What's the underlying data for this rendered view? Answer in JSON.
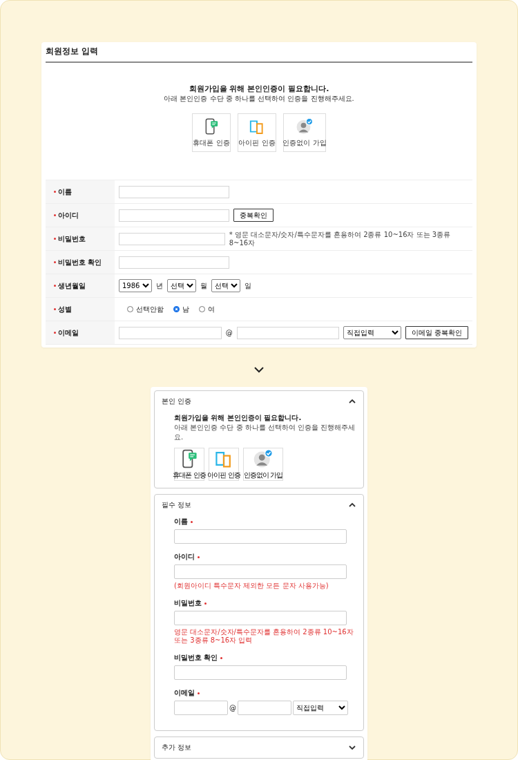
{
  "top_form": {
    "title": "회원정보 입력",
    "intro": {
      "heading": "회원가입을 위해 본인인증이 필요합니다.",
      "sub": "아래 본인인증 수단 중 하나를 선택하여 인증을 진행해주세요."
    },
    "methods": [
      {
        "kind": "phone",
        "label": "휴대폰 인증"
      },
      {
        "kind": "ipin",
        "label": "아이핀 인증"
      },
      {
        "kind": "none",
        "label": "인증없이 가입"
      }
    ],
    "rows": [
      {
        "kind": "text",
        "label": "이름",
        "required": true
      },
      {
        "kind": "text_button",
        "label": "아이디",
        "required": true,
        "button": "중복확인"
      },
      {
        "kind": "text_hint",
        "label": "비밀번호",
        "required": true,
        "hint": "* 영문 대소문자/숫자/특수문자를 혼용하여 2종류 10~16자 또는 3종류 8~16자"
      },
      {
        "kind": "text",
        "label": "비밀번호 확인",
        "required": true
      },
      {
        "kind": "date",
        "label": "생년월일",
        "required": true,
        "parts": [
          {
            "value": "1986",
            "unit": "년"
          },
          {
            "value": "선택",
            "unit": "월"
          },
          {
            "value": "선택",
            "unit": "일"
          }
        ]
      },
      {
        "kind": "radio",
        "label": "성별",
        "required": true,
        "options": [
          {
            "label": "선택안함",
            "selected": false
          },
          {
            "label": "남",
            "selected": true
          },
          {
            "label": "여",
            "selected": false
          }
        ]
      },
      {
        "kind": "email",
        "label": "이메일",
        "required": true,
        "at": "@",
        "select": "직접입력",
        "button": "이메일 중복확인"
      }
    ]
  },
  "mobile_form": {
    "sections": [
      {
        "title": "본인 인증",
        "expanded": true,
        "intro": {
          "heading": "회원가입을 위해 본인인증이 필요합니다.",
          "sub": "아래 본인인증 수단 중 하나를 선택하여 인증을 진행해주세요."
        },
        "methods": [
          {
            "kind": "phone",
            "label": "휴대폰 인증"
          },
          {
            "kind": "ipin",
            "label": "아이핀 인증"
          },
          {
            "kind": "none",
            "label": "인증없이 가입"
          }
        ]
      },
      {
        "title": "필수 정보",
        "expanded": true,
        "fields": [
          {
            "kind": "text",
            "label": "이름",
            "required": true
          },
          {
            "kind": "text",
            "label": "아이디",
            "required": true,
            "hint": "(회원아이디 특수문자 제외한 모든 문자 사용가능)"
          },
          {
            "kind": "text",
            "label": "비밀번호",
            "required": true,
            "hint": "영문 대소문자/숫자/특수문자를 혼용하여 2종류 10~16자 또는 3종류 8~16자 입력"
          },
          {
            "kind": "text",
            "label": "비밀번호 확인",
            "required": true
          },
          {
            "kind": "email",
            "label": "이메일",
            "required": true,
            "at": "@",
            "select": "직접입력"
          }
        ]
      },
      {
        "title": "추가 정보",
        "expanded": false
      }
    ]
  }
}
